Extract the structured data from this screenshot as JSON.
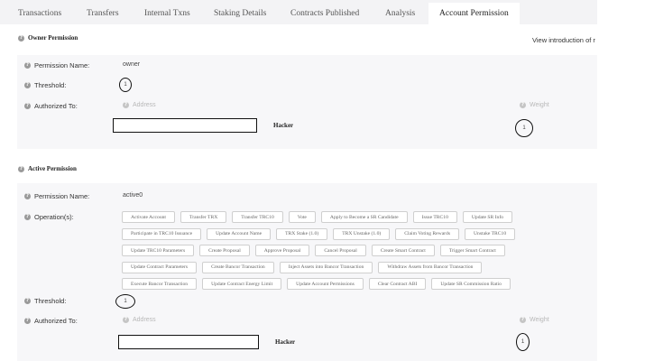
{
  "tabs": [
    {
      "label": "Transactions",
      "active": false
    },
    {
      "label": "Transfers",
      "active": false
    },
    {
      "label": "Internal Txns",
      "active": false
    },
    {
      "label": "Staking Details",
      "active": false
    },
    {
      "label": "Contracts Published",
      "active": false
    },
    {
      "label": "Analysis",
      "active": false
    },
    {
      "label": "Account Permission",
      "active": true
    }
  ],
  "owner": {
    "title": "Owner Permission",
    "intro_link": "View introduction of r",
    "name_label": "Permission Name:",
    "name_value": "owner",
    "threshold_label": "Threshold:",
    "threshold_value": "1",
    "authorized_label": "Authorized To:",
    "address_header": "Address",
    "weight_header": "Weight",
    "address_name": "Hacker",
    "weight_value": "1"
  },
  "active": {
    "title": "Active Permission",
    "name_label": "Permission Name:",
    "name_value": "active0",
    "operations_label": "Operation(s):",
    "operations": [
      [
        "Activate Account",
        "Transfer TRX",
        "Transfer TRC10",
        "Vote",
        "Apply to Become a SR Candidate",
        "Issue TRC10",
        "Update SR Info"
      ],
      [
        "Participate in TRC10 Issuance",
        "Update Account Name",
        "TRX Stake (1.0)",
        "TRX Unstake (1.0)",
        "Claim Voting Rewards",
        "Unstake TRC10"
      ],
      [
        "Update TRC10 Parameters",
        "Create Proposal",
        "Approve Proposal",
        "Cancel Proposal",
        "Create Smart Contract",
        "Trigger Smart Contract"
      ],
      [
        "Update Contract Parameters",
        "Create Bancor Transaction",
        "Inject Assets into Bancor Transaction",
        "Withdraw Assets from Bancor Transaction"
      ],
      [
        "Execute Bancor Transaction",
        "Update Contract Energy Limit",
        "Update Account Permissions",
        "Clear Contract ABI",
        "Update SR Commission Ratio"
      ]
    ],
    "threshold_label": "Threshold:",
    "threshold_value": "1",
    "authorized_label": "Authorized To:",
    "address_header": "Address",
    "weight_header": "Weight",
    "address_name": "Hacker",
    "weight_value": "1"
  }
}
